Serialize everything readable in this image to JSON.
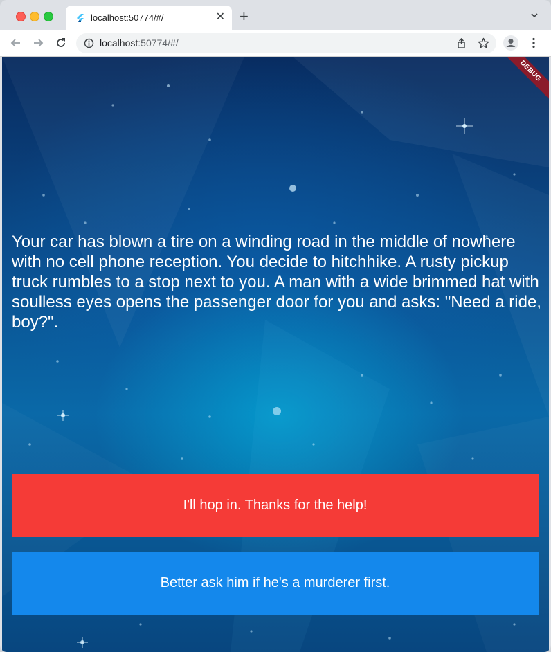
{
  "browser": {
    "tab_title": "localhost:50774/#/",
    "url_host": "localhost",
    "url_rest": ":50774/#/",
    "close_glyph": "✕",
    "new_tab_glyph": "+"
  },
  "app": {
    "debug_banner": "DEBUG",
    "story_text": "Your car has blown a tire on a winding road in the middle of nowhere with no cell phone reception. You decide to hitchhike. A rusty pickup truck rumbles to a stop next to you. A man with a wide brimmed hat with soulless eyes opens the passenger door for you and asks: \"Need a ride, boy?\".",
    "choice1_label": "I'll hop in. Thanks for the help!",
    "choice2_label": "Better ask him if he's a murderer first.",
    "choice1_color": "#f53b37",
    "choice2_color": "#1488ec"
  },
  "icons": [
    "flutter-favicon-icon",
    "back-arrow-icon",
    "forward-arrow-icon",
    "reload-icon",
    "info-icon",
    "share-icon",
    "star-icon",
    "profile-icon",
    "kebab-menu-icon",
    "chevron-down-icon",
    "close-icon"
  ]
}
